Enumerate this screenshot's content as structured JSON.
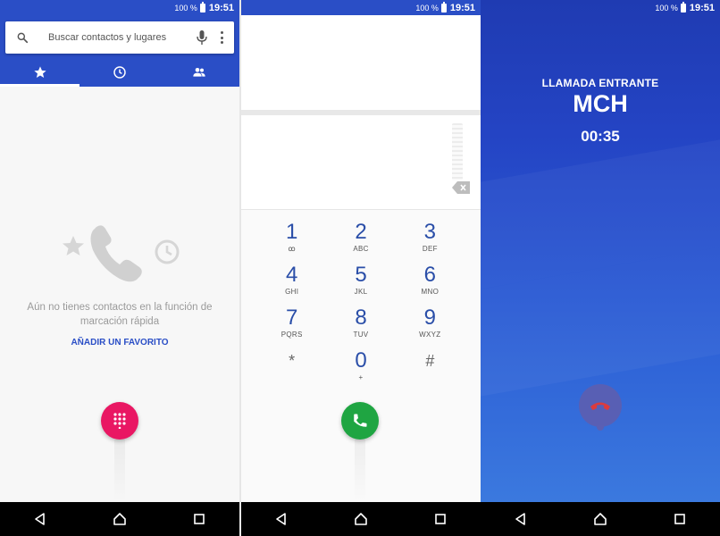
{
  "status": {
    "battery_pct": "100 %",
    "time": "19:51"
  },
  "favorites_screen": {
    "search_placeholder": "Buscar contactos y lugares",
    "tabs": [
      {
        "name": "speed-dial",
        "icon": "star-icon",
        "active": true
      },
      {
        "name": "recents",
        "icon": "clock-icon",
        "active": false
      },
      {
        "name": "contacts",
        "icon": "people-icon",
        "active": false
      }
    ],
    "empty_message": "Aún no tienes contactos en la función de marcación rápida",
    "add_favorite_label": "AÑADIR UN FAVORITO",
    "accent": "#e91763"
  },
  "dialpad_screen": {
    "keys": [
      {
        "digit": "1",
        "letters": "ꝏ"
      },
      {
        "digit": "2",
        "letters": "ABC"
      },
      {
        "digit": "3",
        "letters": "DEF"
      },
      {
        "digit": "4",
        "letters": "GHI"
      },
      {
        "digit": "5",
        "letters": "JKL"
      },
      {
        "digit": "6",
        "letters": "MNO"
      },
      {
        "digit": "7",
        "letters": "PQRS"
      },
      {
        "digit": "8",
        "letters": "TUV"
      },
      {
        "digit": "9",
        "letters": "WXYZ"
      },
      {
        "digit": "*",
        "letters": ""
      },
      {
        "digit": "0",
        "letters": "+"
      },
      {
        "digit": "#",
        "letters": ""
      }
    ],
    "call_color": "#1fa542"
  },
  "incall_screen": {
    "label": "LLAMADA ENTRANTE",
    "caller": "MCH",
    "duration": "00:35"
  },
  "nav": {
    "buttons": [
      "back-icon",
      "home-icon",
      "recents-icon"
    ]
  }
}
